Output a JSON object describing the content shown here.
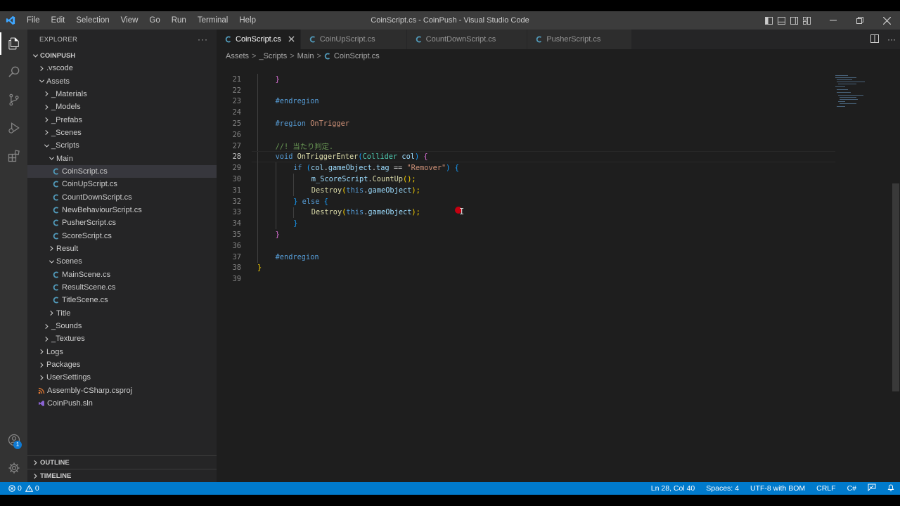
{
  "window": {
    "title": "CoinScript.cs - CoinPush - Visual Studio Code",
    "menu": [
      "File",
      "Edit",
      "Selection",
      "View",
      "Go",
      "Run",
      "Terminal",
      "Help"
    ]
  },
  "activity": {
    "accounts_badge": "1"
  },
  "sidebar": {
    "explorer_label": "EXPLORER",
    "more_label": "···",
    "root_label": "COINPUSH",
    "tree": [
      {
        "label": ".vscode",
        "depth": 1,
        "kind": "folder",
        "open": false
      },
      {
        "label": "Assets",
        "depth": 1,
        "kind": "folder",
        "open": true
      },
      {
        "label": "_Materials",
        "depth": 2,
        "kind": "folder",
        "open": false
      },
      {
        "label": "_Models",
        "depth": 2,
        "kind": "folder",
        "open": false
      },
      {
        "label": "_Prefabs",
        "depth": 2,
        "kind": "folder",
        "open": false
      },
      {
        "label": "_Scenes",
        "depth": 2,
        "kind": "folder",
        "open": false
      },
      {
        "label": "_Scripts",
        "depth": 2,
        "kind": "folder",
        "open": true
      },
      {
        "label": "Main",
        "depth": 3,
        "kind": "folder",
        "open": true
      },
      {
        "label": "CoinScript.cs",
        "depth": 4,
        "kind": "cs",
        "selected": true
      },
      {
        "label": "CoinUpScript.cs",
        "depth": 4,
        "kind": "cs"
      },
      {
        "label": "CountDownScript.cs",
        "depth": 4,
        "kind": "cs"
      },
      {
        "label": "NewBehaviourScript.cs",
        "depth": 4,
        "kind": "cs"
      },
      {
        "label": "PusherScript.cs",
        "depth": 4,
        "kind": "cs"
      },
      {
        "label": "ScoreScript.cs",
        "depth": 4,
        "kind": "cs"
      },
      {
        "label": "Result",
        "depth": 3,
        "kind": "folder",
        "open": false
      },
      {
        "label": "Scenes",
        "depth": 3,
        "kind": "folder",
        "open": true
      },
      {
        "label": "MainScene.cs",
        "depth": 4,
        "kind": "cs"
      },
      {
        "label": "ResultScene.cs",
        "depth": 4,
        "kind": "cs"
      },
      {
        "label": "TitleScene.cs",
        "depth": 4,
        "kind": "cs"
      },
      {
        "label": "Title",
        "depth": 3,
        "kind": "folder",
        "open": false
      },
      {
        "label": "_Sounds",
        "depth": 2,
        "kind": "folder",
        "open": false
      },
      {
        "label": "_Textures",
        "depth": 2,
        "kind": "folder",
        "open": false
      },
      {
        "label": "Logs",
        "depth": 1,
        "kind": "folder",
        "open": false
      },
      {
        "label": "Packages",
        "depth": 1,
        "kind": "folder",
        "open": false
      },
      {
        "label": "UserSettings",
        "depth": 1,
        "kind": "folder",
        "open": false
      },
      {
        "label": "Assembly-CSharp.csproj",
        "depth": 1,
        "kind": "rss"
      },
      {
        "label": "CoinPush.sln",
        "depth": 1,
        "kind": "sln"
      }
    ],
    "outline_label": "OUTLINE",
    "timeline_label": "TIMELINE"
  },
  "tabs": [
    {
      "label": "CoinScript.cs",
      "active": true
    },
    {
      "label": "CoinUpScript.cs",
      "active": false
    },
    {
      "label": "CountDownScript.cs",
      "active": false
    },
    {
      "label": "PusherScript.cs",
      "active": false
    }
  ],
  "breadcrumb": {
    "items": [
      "Assets",
      "_Scripts",
      "Main"
    ],
    "file": "CoinScript.cs",
    "separator": ">"
  },
  "code": {
    "current_line": 28,
    "lines": [
      {
        "n": 21,
        "indent": 1,
        "tokens": [
          {
            "t": "}",
            "c": "br2"
          }
        ]
      },
      {
        "n": 22,
        "indent": 0,
        "tokens": []
      },
      {
        "n": 23,
        "indent": 1,
        "tokens": [
          {
            "t": "#endregion",
            "c": "rg"
          }
        ]
      },
      {
        "n": 24,
        "indent": 0,
        "tokens": []
      },
      {
        "n": 25,
        "indent": 1,
        "tokens": [
          {
            "t": "#region ",
            "c": "rg"
          },
          {
            "t": "OnTrigger",
            "c": "st"
          }
        ]
      },
      {
        "n": 26,
        "indent": 0,
        "tokens": []
      },
      {
        "n": 27,
        "indent": 1,
        "tokens": [
          {
            "t": "//! 当たり判定.",
            "c": "cm"
          }
        ]
      },
      {
        "n": 28,
        "indent": 1,
        "tokens": [
          {
            "t": "void ",
            "c": "kw"
          },
          {
            "t": "OnTriggerEnter",
            "c": "fn"
          },
          {
            "t": "(",
            "c": "br3"
          },
          {
            "t": "Collider ",
            "c": "ty"
          },
          {
            "t": "col",
            "c": "var"
          },
          {
            "t": ") ",
            "c": "br3"
          },
          {
            "t": "{",
            "c": "br2"
          }
        ]
      },
      {
        "n": 29,
        "indent": 2,
        "tokens": [
          {
            "t": "if ",
            "c": "kw"
          },
          {
            "t": "(",
            "c": "br3"
          },
          {
            "t": "col",
            "c": "var"
          },
          {
            "t": ".",
            "c": ""
          },
          {
            "t": "gameObject",
            "c": "var"
          },
          {
            "t": ".",
            "c": ""
          },
          {
            "t": "tag",
            "c": "var"
          },
          {
            "t": " == ",
            "c": ""
          },
          {
            "t": "\"Remover\"",
            "c": "st"
          },
          {
            "t": ") ",
            "c": "br3"
          },
          {
            "t": "{",
            "c": "br3"
          }
        ]
      },
      {
        "n": 30,
        "indent": 3,
        "tokens": [
          {
            "t": "m_ScoreScript",
            "c": "var"
          },
          {
            "t": ".",
            "c": ""
          },
          {
            "t": "CountUp",
            "c": "fn"
          },
          {
            "t": "();",
            "c": "br1"
          }
        ]
      },
      {
        "n": 31,
        "indent": 3,
        "tokens": [
          {
            "t": "Destroy",
            "c": "fn"
          },
          {
            "t": "(",
            "c": "br1"
          },
          {
            "t": "this",
            "c": "kw"
          },
          {
            "t": ".",
            "c": ""
          },
          {
            "t": "gameObject",
            "c": "var"
          },
          {
            "t": ");",
            "c": "br1"
          }
        ]
      },
      {
        "n": 32,
        "indent": 2,
        "tokens": [
          {
            "t": "} ",
            "c": "br3"
          },
          {
            "t": "else ",
            "c": "kw"
          },
          {
            "t": "{",
            "c": "br3"
          }
        ]
      },
      {
        "n": 33,
        "indent": 3,
        "tokens": [
          {
            "t": "Destroy",
            "c": "fn"
          },
          {
            "t": "(",
            "c": "br1"
          },
          {
            "t": "this",
            "c": "kw"
          },
          {
            "t": ".",
            "c": ""
          },
          {
            "t": "gameObject",
            "c": "var"
          },
          {
            "t": ");",
            "c": "br1"
          }
        ]
      },
      {
        "n": 34,
        "indent": 2,
        "tokens": [
          {
            "t": "}",
            "c": "br3"
          }
        ]
      },
      {
        "n": 35,
        "indent": 1,
        "tokens": [
          {
            "t": "}",
            "c": "br2"
          }
        ]
      },
      {
        "n": 36,
        "indent": 0,
        "tokens": []
      },
      {
        "n": 37,
        "indent": 1,
        "tokens": [
          {
            "t": "#endregion",
            "c": "rg"
          }
        ]
      },
      {
        "n": 38,
        "indent": 0,
        "tokens": [
          {
            "t": "}",
            "c": "br1"
          }
        ]
      },
      {
        "n": 39,
        "indent": 0,
        "tokens": []
      }
    ]
  },
  "status": {
    "errors": "0",
    "warnings": "0",
    "position": "Ln 28, Col 40",
    "spaces": "Spaces: 4",
    "encoding": "UTF-8 with BOM",
    "eol": "CRLF",
    "language": "C#"
  },
  "colors": {
    "accent": "#007acc",
    "cs_icon": "#519aba",
    "rss_icon": "#e37933",
    "sln_icon": "#8a63d2"
  }
}
